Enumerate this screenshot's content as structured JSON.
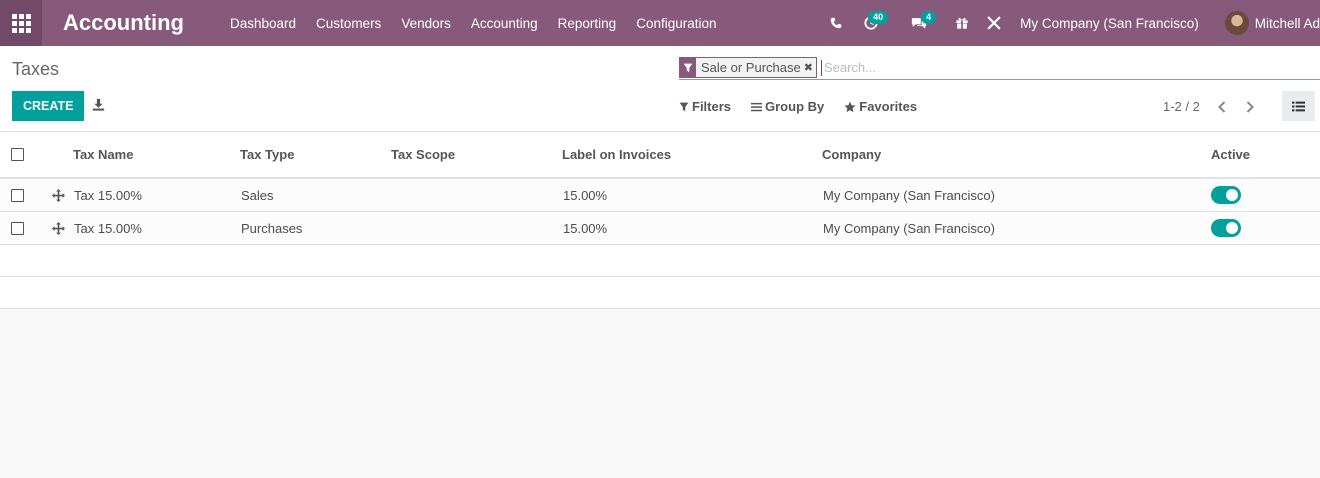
{
  "navbar": {
    "app_name": "Accounting",
    "menu": [
      "Dashboard",
      "Customers",
      "Vendors",
      "Accounting",
      "Reporting",
      "Configuration"
    ],
    "activity_count": "40",
    "message_count": "4",
    "company": "My Company (San Francisco)",
    "user": "Mitchell Ad",
    "icons": [
      "apps-grid-icon",
      "phone-icon",
      "clock-icon",
      "chat-icon",
      "gift-icon",
      "tools-icon"
    ]
  },
  "control": {
    "breadcrumb": "Taxes",
    "create_label": "CREATE",
    "facet_value": "Sale or Purchase",
    "facet_remove": "✖",
    "search_placeholder": "Search...",
    "filters_label": "Filters",
    "groupby_label": "Group By",
    "favorites_label": "Favorites",
    "pager": "1-2 / 2"
  },
  "table": {
    "columns": [
      "Tax Name",
      "Tax Type",
      "Tax Scope",
      "Label on Invoices",
      "Company",
      "Active"
    ],
    "rows": [
      {
        "name": "Tax 15.00%",
        "type": "Sales",
        "scope": "",
        "label": "15.00%",
        "company": "My Company (San Francisco)",
        "active": true
      },
      {
        "name": "Tax 15.00%",
        "type": "Purchases",
        "scope": "",
        "label": "15.00%",
        "company": "My Company (San Francisco)",
        "active": true
      }
    ]
  },
  "colors": {
    "brand": "#875a7b",
    "brand_dark": "#714a67",
    "accent": "#00a09d"
  }
}
